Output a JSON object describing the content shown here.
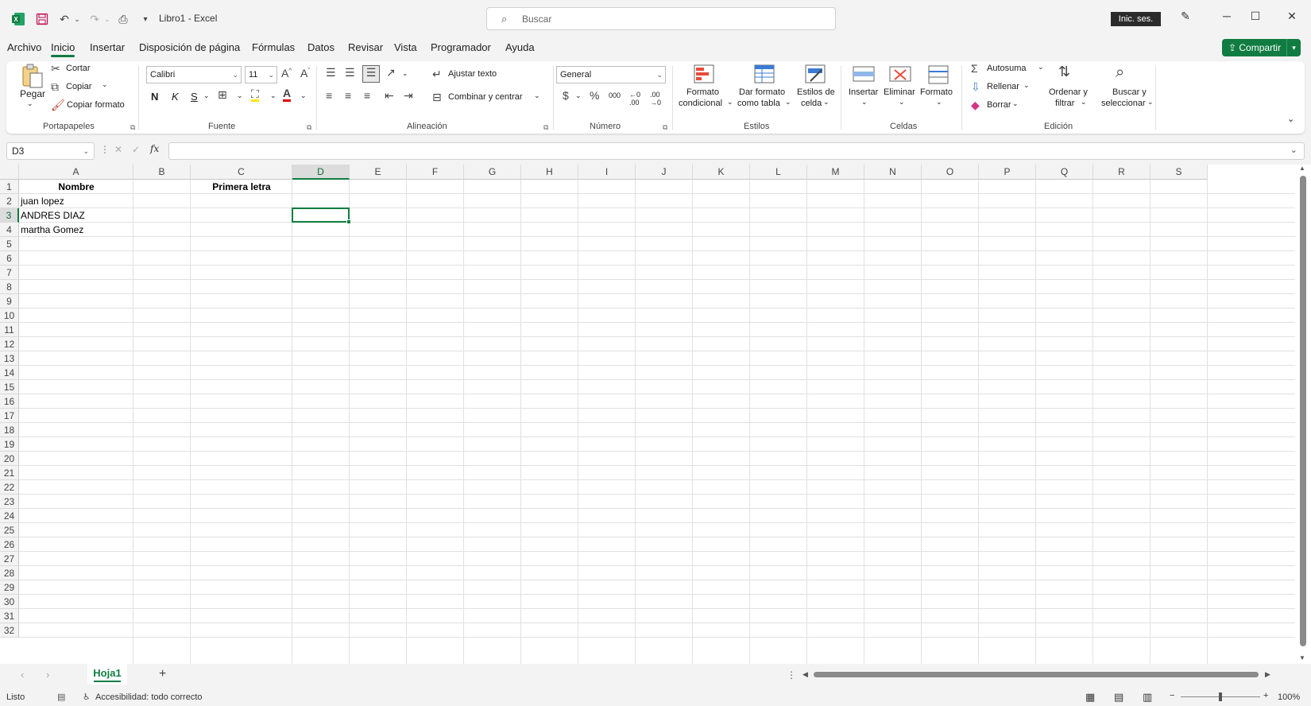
{
  "app": {
    "title": "Libro1  -  Excel",
    "search_placeholder": "Buscar",
    "signin_label": "Inic. ses.",
    "share_label": "Compartir"
  },
  "menu": {
    "tabs": [
      "Archivo",
      "Inicio",
      "Insertar",
      "Disposición de página",
      "Fórmulas",
      "Datos",
      "Revisar",
      "Vista",
      "Programador",
      "Ayuda"
    ],
    "active": "Inicio"
  },
  "ribbon": {
    "clipboard": {
      "paste": "Pegar",
      "cut": "Cortar",
      "copy": "Copiar",
      "format_painter": "Copiar formato",
      "label": "Portapapeles"
    },
    "font": {
      "name": "Calibri",
      "size": "11",
      "bold": "N",
      "italic": "K",
      "underline": "S",
      "label": "Fuente"
    },
    "alignment": {
      "wrap": "Ajustar texto",
      "merge": "Combinar y centrar",
      "label": "Alineación"
    },
    "number": {
      "format": "General",
      "label": "Número"
    },
    "styles": {
      "cond_1": "Formato",
      "cond_2": "condicional",
      "table_1": "Dar formato",
      "table_2": "como tabla",
      "cell_1": "Estilos de",
      "cell_2": "celda",
      "label": "Estilos"
    },
    "cells": {
      "insert": "Insertar",
      "delete": "Eliminar",
      "format": "Formato",
      "label": "Celdas"
    },
    "editing": {
      "autosum": "Autosuma",
      "fill": "Rellenar",
      "clear": "Borrar",
      "sort_1": "Ordenar y",
      "sort_2": "filtrar",
      "find_1": "Buscar y",
      "find_2": "seleccionar",
      "label": "Edición"
    }
  },
  "formula_bar": {
    "name_box": "D3",
    "fx": "fx",
    "value": ""
  },
  "sheet": {
    "columns": [
      "A",
      "B",
      "C",
      "D",
      "E",
      "F",
      "G",
      "H",
      "I",
      "J",
      "K",
      "L",
      "M",
      "N",
      "O",
      "P",
      "Q",
      "R",
      "S"
    ],
    "rows": [
      "1",
      "2",
      "3",
      "4",
      "5",
      "6",
      "7",
      "8",
      "9",
      "10",
      "11",
      "12",
      "13",
      "14",
      "15",
      "16",
      "17",
      "18",
      "19",
      "20",
      "21",
      "22",
      "23",
      "24",
      "25",
      "26",
      "27",
      "28",
      "29",
      "30",
      "31",
      "32"
    ],
    "selected_column": "D",
    "selected_row": "3",
    "cells": {
      "A1": "Nombre",
      "C1": "Primera letra",
      "A2": "juan lopez",
      "A3": "ANDRES DIAZ",
      "A4": "martha Gomez"
    }
  },
  "sheet_tabs": {
    "active": "Hoja1",
    "add": "+"
  },
  "status": {
    "ready": "Listo",
    "accessibility": "Accesibilidad: todo correcto",
    "zoom": "100%"
  }
}
